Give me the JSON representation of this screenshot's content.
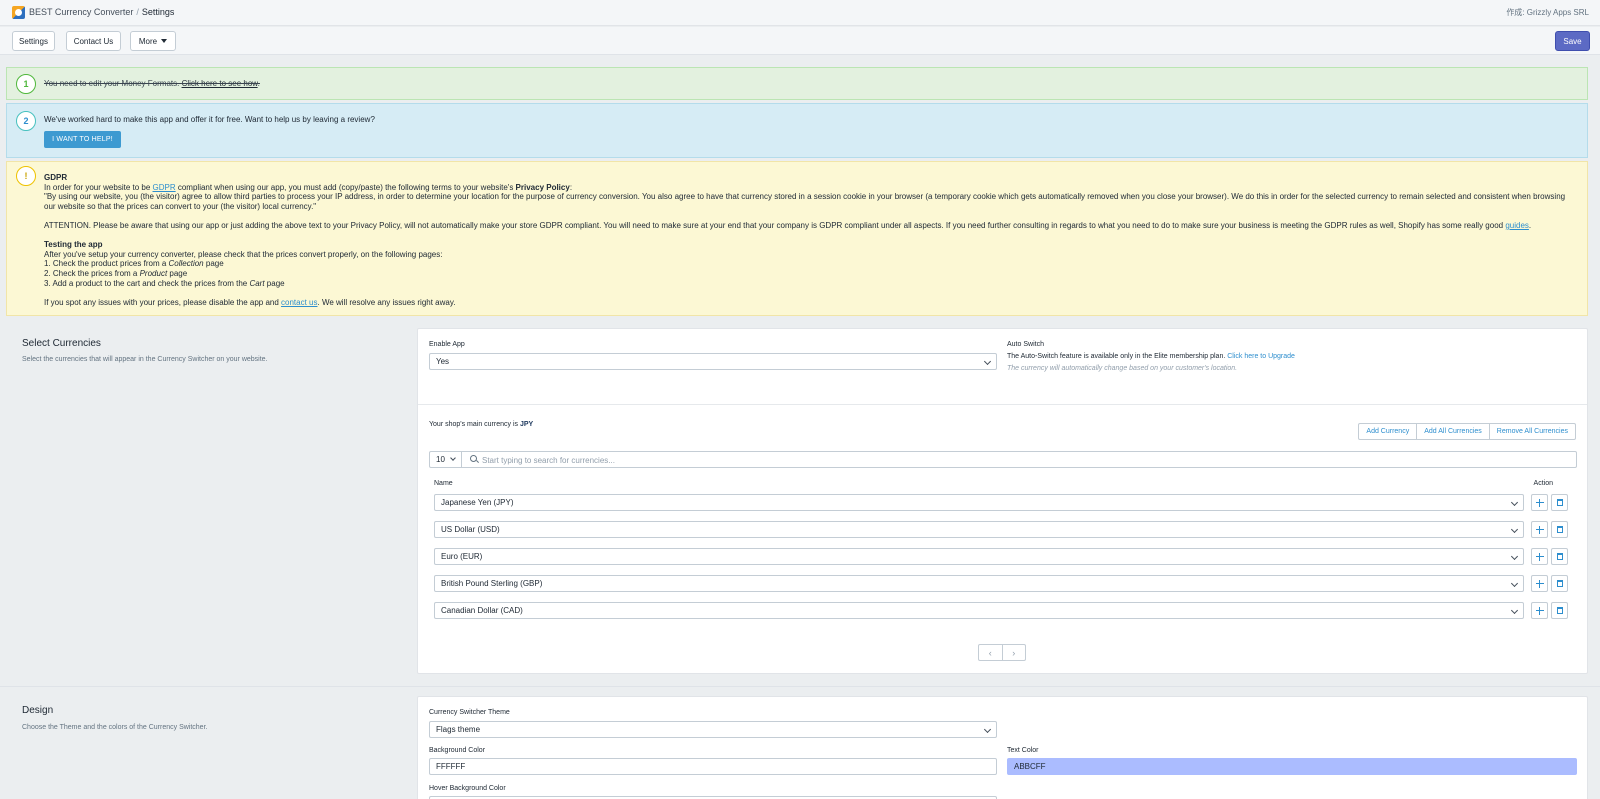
{
  "header": {
    "app_name": "BEST Currency Converter",
    "separator": "/",
    "page": "Settings",
    "author": "作成: Grizzly Apps SRL"
  },
  "toolbar": {
    "settings_label": "Settings",
    "contact_label": "Contact Us",
    "more_label": "More",
    "save_label": "Save"
  },
  "notices": {
    "n1": {
      "number": "1",
      "text": "You need to edit your Money Formats. ",
      "link": "Click here to see how",
      "suffix": "."
    },
    "n2": {
      "number": "2",
      "text": "We've worked hard to make this app and offer it for free. Want to help us by leaving a review?",
      "button": "I WANT TO HELP!"
    },
    "n3": {
      "badge": "!",
      "title": "GDPR",
      "line1_a": "In order for your website to be ",
      "line1_link": "GDPR",
      "line1_b": " compliant when using our app, you must add (copy/paste) the following terms to your website's ",
      "line1_bold": "Privacy Policy",
      "line1_c": ":",
      "quote": "\"By using our website, you (the visitor) agree to allow third parties to process your IP address, in order to determine your location for the purpose of currency conversion. You also agree to have that currency stored in a session cookie in your browser (a temporary cookie which gets automatically removed when you close your browser). We do this in order for the selected currency to remain selected and consistent when browsing our website so that the prices can convert to your (the visitor) local currency.\"",
      "attention": "ATTENTION. Please be aware that using our app or just adding the above text to your Privacy Policy, will not automatically make your store GDPR compliant. You will need to make sure at your end that your company is GDPR compliant under all aspects. If you need further consulting in regards to what you need to do to make sure your business is meeting the GDPR rules as well, Shopify has some really good ",
      "attention_link": "guides",
      "attention_end": ".",
      "testing_title": "Testing the app",
      "testing_intro": "After you've setup your currency converter, please check that the prices convert properly, on the following pages:",
      "step1_a": "1. Check the product prices from a ",
      "step1_i": "Collection",
      "step1_b": " page",
      "step2_a": "2. Check the prices from a ",
      "step2_i": "Product",
      "step2_b": " page",
      "step3_a": "3. Add a product to the cart and check the prices from the ",
      "step3_i": "Cart",
      "step3_b": " page",
      "issues_a": "If you spot any issues with your prices, please disable the app and ",
      "issues_link": "contact us",
      "issues_b": ". We will resolve any issues right away."
    }
  },
  "currencies_section": {
    "title": "Select Currencies",
    "description": "Select the currencies that will appear in the Currency Switcher on your website.",
    "enable_label": "Enable App",
    "enable_value": "Yes",
    "auto_switch_label": "Auto Switch",
    "auto_switch_text": "The Auto-Switch feature is available only in the Elite membership plan. ",
    "auto_switch_link": "Click here to Upgrade",
    "auto_switch_note": "The currency will automatically change based on your customer's location.",
    "main_currency_text": "Your shop's main currency is ",
    "main_currency": "JPY",
    "add_currency": "Add Currency",
    "add_all": "Add All Currencies",
    "remove_all": "Remove All Currencies",
    "per_page": "10",
    "search_placeholder": "Start typing to search for currencies...",
    "col_name": "Name",
    "col_action": "Action",
    "rows": [
      "Japanese Yen (JPY)",
      "US Dollar (USD)",
      "Euro (EUR)",
      "British Pound Sterling (GBP)",
      "Canadian Dollar (CAD)"
    ],
    "prev_glyph": "‹",
    "next_glyph": "›"
  },
  "design_section": {
    "title": "Design",
    "description": "Choose the Theme and the colors of the Currency Switcher.",
    "theme_label": "Currency Switcher Theme",
    "theme_value": "Flags theme",
    "bg_label": "Background Color",
    "bg_value": "FFFFFF",
    "text_color_label": "Text Color",
    "text_color_value": "ABBCFF",
    "hover_bg_label": "Hover Background Color"
  },
  "colors": {
    "accent": "#5c6ac4",
    "link": "#2d8ece",
    "text_color_swatch": "#abbcff",
    "bg_swatch": "#ffffff"
  },
  "icons": {
    "move": "move-icon",
    "delete": "trash-icon",
    "search": "search-icon"
  }
}
